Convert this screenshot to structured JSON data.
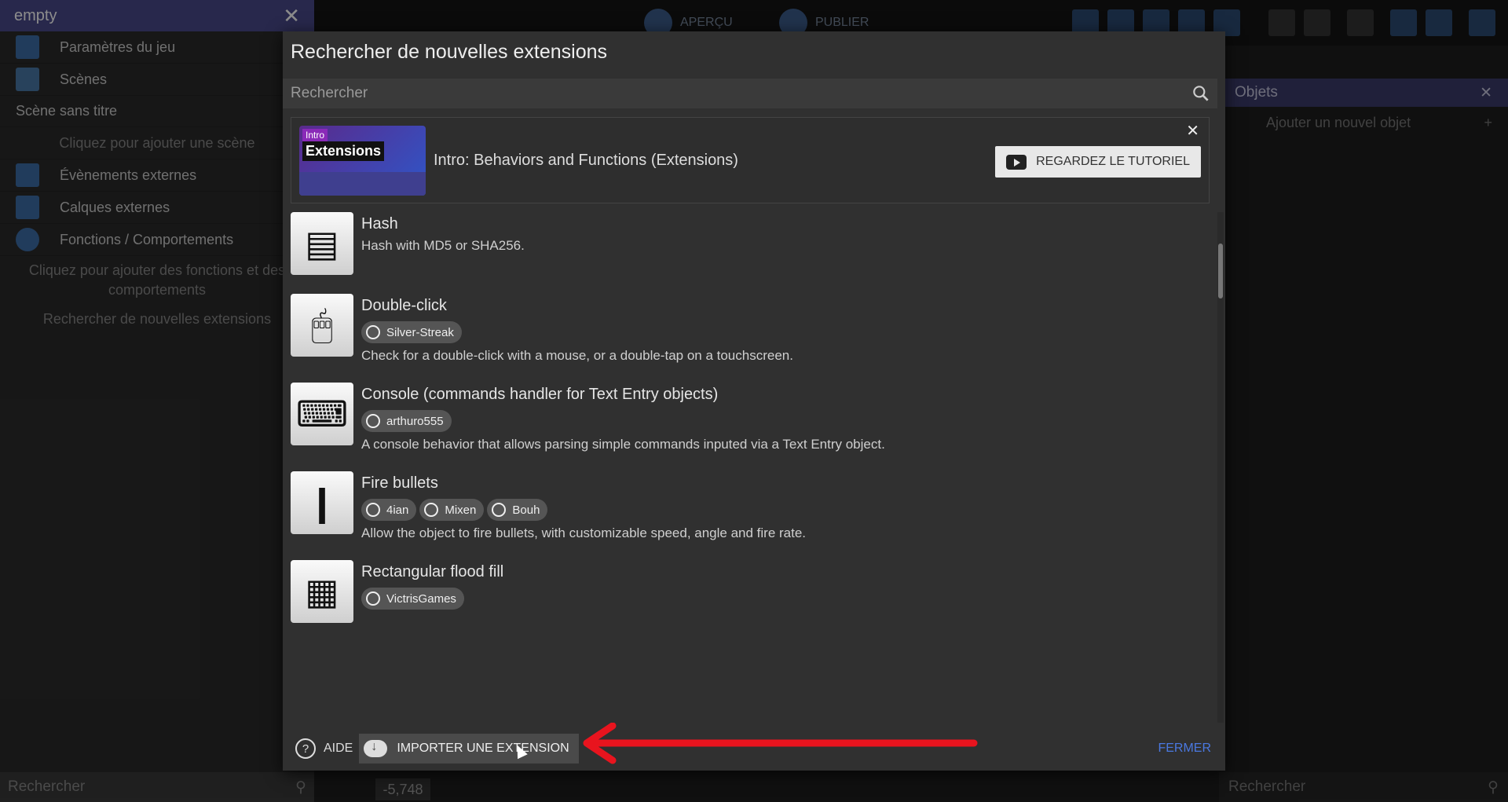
{
  "project_panel": {
    "title": "empty",
    "items": {
      "game_settings": "Paramètres du jeu",
      "scenes": "Scènes",
      "scene_untitled": "Scène sans titre",
      "add_scene": "Cliquez pour ajouter une scène",
      "external_events": "Évènements externes",
      "external_layouts": "Calques externes",
      "functions": "Fonctions / Comportements",
      "add_functions": "Cliquez pour ajouter des fonctions et des comportements",
      "search_extensions": "Rechercher de nouvelles extensions"
    },
    "search_placeholder": "Rechercher"
  },
  "toolbar": {
    "preview_label": "APERÇU",
    "publish_label": "PUBLIER"
  },
  "objects_panel": {
    "title": "Objets",
    "add_label": "Ajouter un nouvel objet",
    "search_placeholder": "Rechercher"
  },
  "canvas": {
    "coordinate": "-5,748"
  },
  "dialog": {
    "title": "Rechercher de nouvelles extensions",
    "search_placeholder": "Rechercher",
    "tutorial": {
      "thumb_tag": "Intro",
      "thumb_title": "Extensions",
      "title": "Intro: Behaviors and Functions (Extensions)",
      "button": "REGARDEZ LE TUTORIEL"
    },
    "extensions": [
      {
        "name": "Hash",
        "description": "Hash with MD5 or SHA256.",
        "authors": []
      },
      {
        "name": "Double-click",
        "description": "Check for a double-click with a mouse, or a double-tap on a touchscreen.",
        "authors": [
          "Silver-Streak"
        ]
      },
      {
        "name": "Console (commands handler for Text Entry objects)",
        "description": "A console behavior that allows parsing simple commands inputed via a Text Entry object.",
        "authors": [
          "arthuro555"
        ]
      },
      {
        "name": "Fire bullets",
        "description": "Allow the object to fire bullets, with customizable speed, angle and fire rate.",
        "authors": [
          "4ian",
          "Mixen",
          "Bouh"
        ]
      },
      {
        "name": "Rectangular flood fill",
        "description": "",
        "authors": [
          "VictrisGames"
        ]
      }
    ],
    "footer": {
      "help": "AIDE",
      "import": "IMPORTER UNE EXTENSION",
      "close": "FERMER"
    }
  },
  "colors": {
    "accent_link": "#4a78e0",
    "annotation_arrow": "#e8141e",
    "project_header": "#4a4a8a"
  }
}
